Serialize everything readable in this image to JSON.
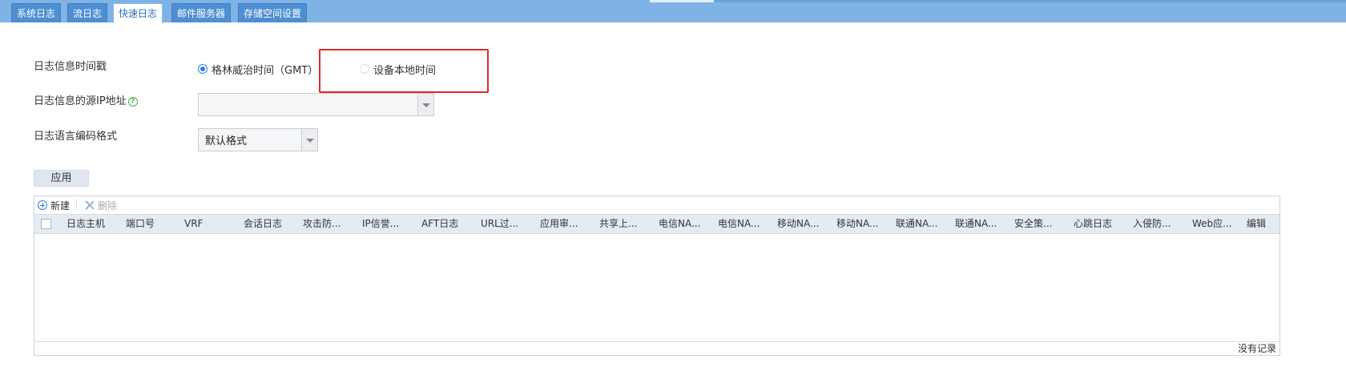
{
  "tabs": [
    {
      "label": "系统日志",
      "active": false
    },
    {
      "label": "流日志",
      "active": false
    },
    {
      "label": "快速日志",
      "active": true
    },
    {
      "label": "邮件服务器",
      "active": false
    },
    {
      "label": "存储空间设置",
      "active": false
    }
  ],
  "form": {
    "timestamp_label": "日志信息时间戳",
    "timestamp_options": [
      {
        "label": "格林威治时间（GMT）",
        "checked": true
      },
      {
        "label": "设备本地时间",
        "checked": false
      }
    ],
    "source_ip_label": "日志信息的源IP地址",
    "source_ip_value": "",
    "encoding_label": "日志语言编码格式",
    "encoding_value": "默认格式",
    "apply_label": "应用"
  },
  "grid": {
    "toolbar": {
      "new_label": "新建",
      "delete_label": "删除"
    },
    "columns": [
      "日志主机",
      "端口号",
      "VRF",
      "会话日志",
      "攻击防...",
      "IP信誉...",
      "AFT日志",
      "URL过...",
      "应用审...",
      "共享上...",
      "电信NA...",
      "电信NA...",
      "移动NA...",
      "移动NA...",
      "联通NA...",
      "联通NA...",
      "安全策...",
      "心跳日志",
      "入侵防...",
      "Web应...",
      "编辑"
    ],
    "rows": [],
    "empty_text": "没有记录"
  },
  "colors": {
    "accent": "#2a7ed8",
    "tabbar": "#7fb3e6",
    "highlight": "#e0282a"
  }
}
